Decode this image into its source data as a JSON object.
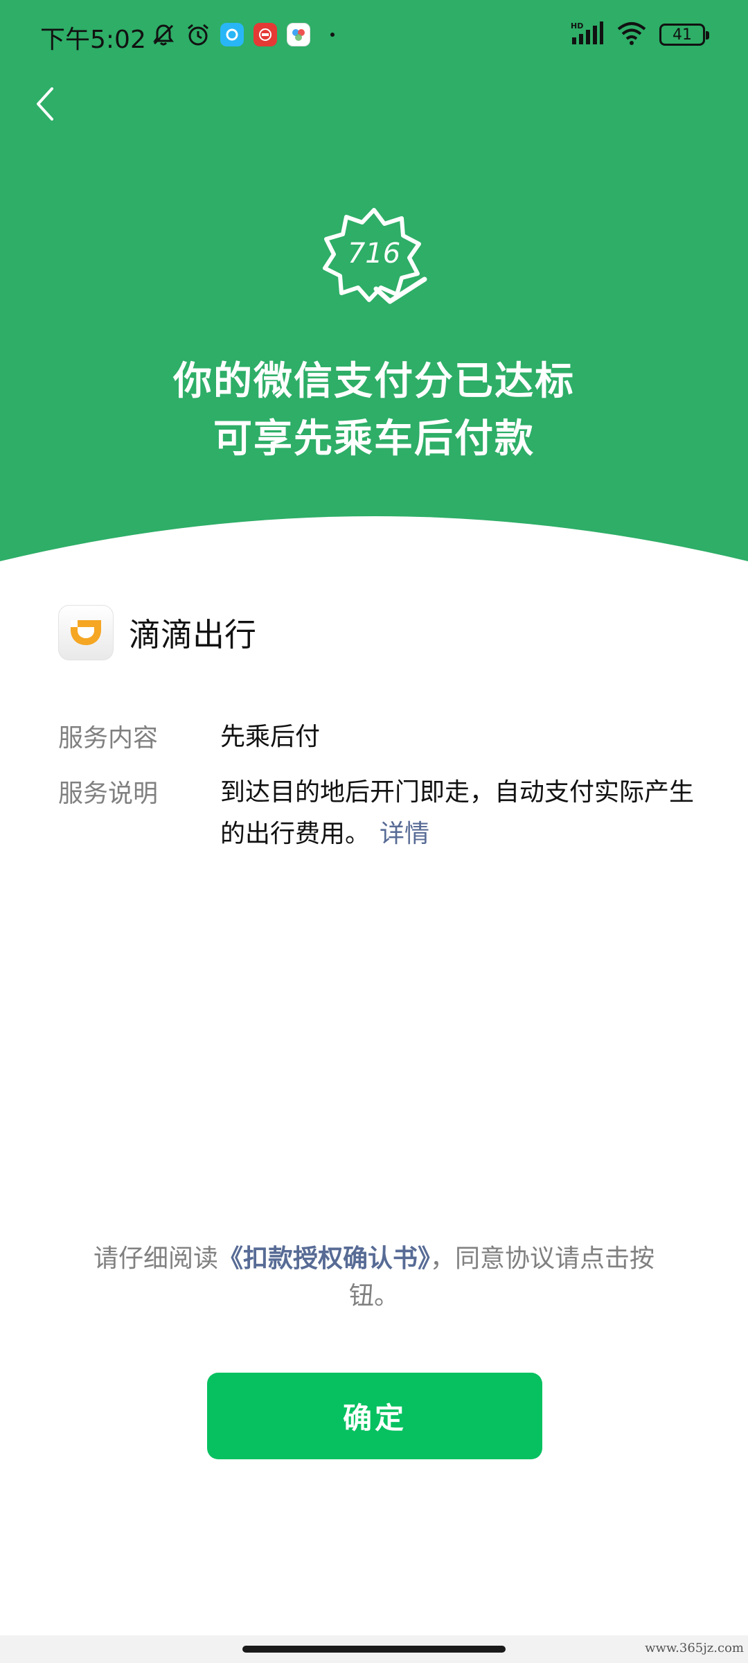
{
  "status_bar": {
    "time": "下午5:02",
    "battery": "41",
    "app_badge_colors": [
      "#29b6f6",
      "#e53935",
      "#42a5f5"
    ]
  },
  "hero": {
    "score": "716",
    "title_line1": "你的微信支付分已达标",
    "title_line2": "可享先乘车后付款",
    "bg_color": "#2eae67"
  },
  "merchant": {
    "name": "滴滴出行",
    "logo_icon": "didi-logo-icon"
  },
  "service": {
    "content_label": "服务内容",
    "content_value": "先乘后付",
    "desc_label": "服务说明",
    "desc_value": "到达目的地后开门即走，自动支付实际产生的出行费用。",
    "detail_link": "详情"
  },
  "agreement": {
    "prefix": "请仔细阅读",
    "link": "《扣款授权确认书》",
    "suffix": "，同意协议请点击按钮。"
  },
  "confirm_button": {
    "label": "确定",
    "color": "#07c160"
  },
  "watermark": "www.365jz.com"
}
